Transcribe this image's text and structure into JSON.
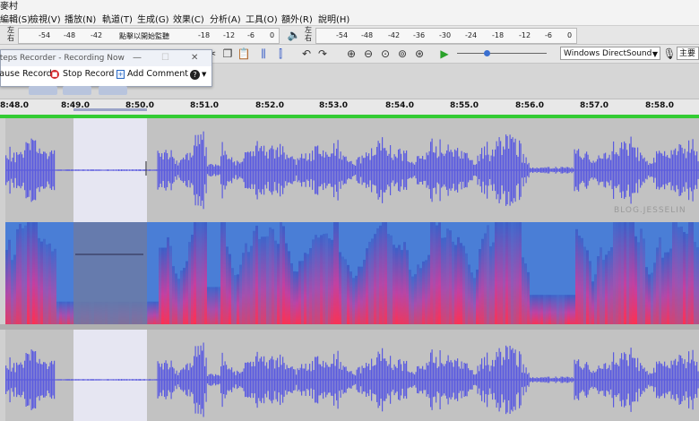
{
  "window": {
    "title": "麥村"
  },
  "menu": [
    "編輯(S)",
    "檢視(V)",
    "播放(N)",
    "軌道(T)",
    "生成(G)",
    "效果(C)",
    "分析(A)",
    "工具(O)",
    "額外(R)",
    "說明(H)"
  ],
  "record_meter": {
    "lr": [
      "左",
      "右"
    ],
    "ticks": [
      "-54",
      "-48",
      "-42",
      "點擊以開始監聽",
      "-18",
      "-12",
      "-6",
      "0"
    ]
  },
  "play_meter": {
    "lr": [
      "左",
      "右"
    ],
    "ticks": [
      "-54",
      "-48",
      "-42",
      "-36",
      "-30",
      "-24",
      "-18",
      "-12",
      "-6",
      "0"
    ]
  },
  "edit_toolbar": {
    "icons": [
      "cut-icon",
      "copy-icon",
      "paste-icon",
      "trim-icon",
      "silence-icon",
      "undo-icon",
      "redo-icon",
      "zoom-in-icon",
      "zoom-out-icon",
      "fit-selection-icon",
      "fit-project-icon",
      "zoom-toggle-icon",
      "play-at-speed-icon"
    ],
    "device": "Windows DirectSound",
    "device_suffix": "主要聲"
  },
  "steps_recorder": {
    "title": "Steps Recorder - Recording Now",
    "pause": "Pause Record",
    "stop": "Stop Record",
    "add_comment": "Add Comment"
  },
  "timeline": {
    "labels": [
      "8:48.0",
      "8:49.0",
      "8:50.0",
      "8:51.0",
      "8:52.0",
      "8:53.0",
      "8:54.0",
      "8:55.0",
      "8:56.0",
      "8:57.0",
      "8:58.0"
    ]
  },
  "watermark": "BLOG.JESSELIN"
}
